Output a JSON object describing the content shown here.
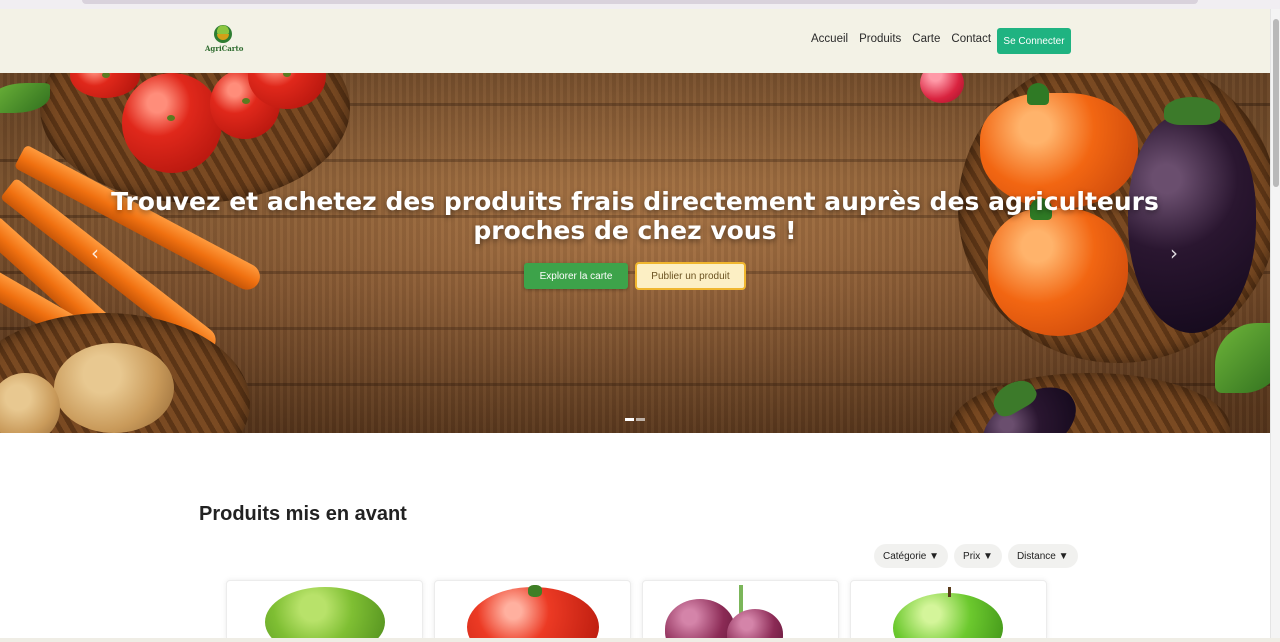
{
  "brand": {
    "logo_text": "AgriCarto"
  },
  "nav": {
    "items": [
      {
        "label": "Accueil"
      },
      {
        "label": "Produits"
      },
      {
        "label": "Carte"
      },
      {
        "label": "Contact"
      }
    ],
    "login_label": "Se Connecter"
  },
  "hero": {
    "title_line1": "Trouvez et achetez des produits frais directement auprès des agriculteurs",
    "title_line2": "proches de chez vous !",
    "explore_label": "Explorer la carte",
    "publish_label": "Publier un produit",
    "prev_icon": "‹",
    "next_icon": "›",
    "slide_count": 2,
    "active_slide": 1
  },
  "featured": {
    "title": "Produits mis en avant",
    "filters": [
      {
        "label": "Catégorie ▼"
      },
      {
        "label": "Prix ▼"
      },
      {
        "label": "Distance ▼"
      }
    ],
    "products": [
      {
        "image": "lettuce"
      },
      {
        "image": "tomato"
      },
      {
        "image": "red-onion"
      },
      {
        "image": "green-apple"
      }
    ]
  },
  "colors": {
    "primary_green": "#1fb381",
    "explore_green": "#3da34a",
    "publish_bg": "#fcefc4",
    "publish_border": "#f0b62e",
    "header_bg": "#f3f2e6"
  }
}
